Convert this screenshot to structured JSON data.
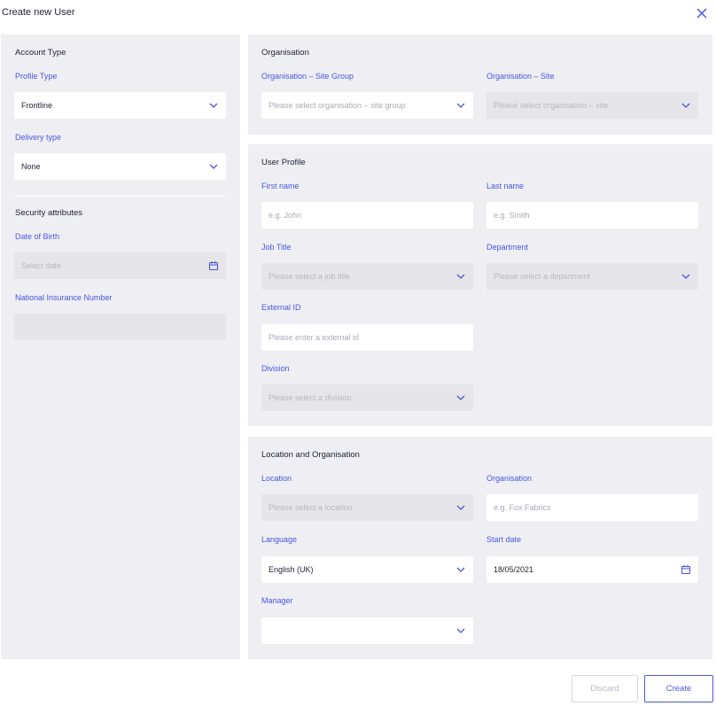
{
  "dialog": {
    "title": "Create new User"
  },
  "account": {
    "title": "Account Type",
    "profile_type": {
      "label": "Profile Type",
      "value": "Frontline"
    },
    "delivery_type": {
      "label": "Delivery type",
      "value": "None"
    },
    "security_title": "Security attributes",
    "dob": {
      "label": "Date of Birth",
      "placeholder": "Select date"
    },
    "nin": {
      "label": "National Insurance Number",
      "value": ""
    }
  },
  "organisation": {
    "title": "Organisation",
    "site_group": {
      "label": "Organisation – Site Group",
      "placeholder": "Please select organisation – site group"
    },
    "site": {
      "label": "Organisation – Site",
      "placeholder": "Please select organisation – site"
    }
  },
  "user_profile": {
    "title": "User Profile",
    "first_name": {
      "label": "First name",
      "placeholder": "e.g. John"
    },
    "last_name": {
      "label": "Last name",
      "placeholder": "e.g. Smith"
    },
    "job_title": {
      "label": "Job Title",
      "placeholder": "Please select a job title"
    },
    "department": {
      "label": "Department",
      "placeholder": "Please select a department"
    },
    "external_id": {
      "label": "External ID",
      "placeholder": "Please enter a external id"
    },
    "division": {
      "label": "Division",
      "placeholder": "Please select a division"
    }
  },
  "location_org": {
    "title": "Location and Organisation",
    "location": {
      "label": "Location",
      "placeholder": "Please select a location"
    },
    "organisation": {
      "label": "Organisation",
      "placeholder": "e.g. Fox Fabrics"
    },
    "language": {
      "label": "Language",
      "value": "English (UK)"
    },
    "start_date": {
      "label": "Start date",
      "value": "18/05/2021"
    },
    "manager": {
      "label": "Manager",
      "value": ""
    }
  },
  "footer": {
    "discard": "Discard",
    "create": "Create"
  },
  "colors": {
    "accent": "#4a56e2",
    "panel": "#eeeef3",
    "disabled_field": "#e5e5ea"
  },
  "icons": {
    "close": "close-icon",
    "dropdown": "chevron-down-icon",
    "calendar": "calendar-icon"
  }
}
